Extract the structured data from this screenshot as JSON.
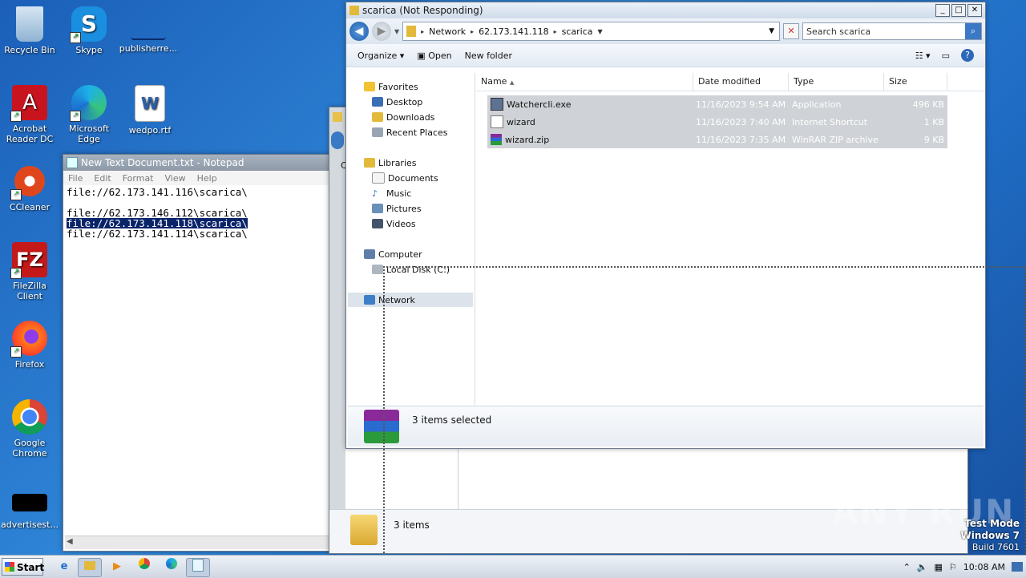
{
  "desktop": {
    "icons": [
      {
        "label": "Recycle Bin",
        "icon": "recycle-bin-icon"
      },
      {
        "label": "Skype",
        "icon": "skype-icon"
      },
      {
        "label": "publisherre...",
        "icon": "file-icon"
      },
      {
        "label": "Acrobat Reader DC",
        "icon": "acrobat-icon"
      },
      {
        "label": "Microsoft Edge",
        "icon": "edge-icon"
      },
      {
        "label": "wedpo.rtf",
        "icon": "word-document-icon"
      },
      {
        "label": "CCleaner",
        "icon": "ccleaner-icon"
      },
      {
        "label": "FileZilla Client",
        "icon": "filezilla-icon"
      },
      {
        "label": "Firefox",
        "icon": "firefox-icon"
      },
      {
        "label": "Google Chrome",
        "icon": "chrome-icon"
      },
      {
        "label": "advertisest...",
        "icon": "file-icon"
      }
    ]
  },
  "notepad": {
    "title": "New Text Document.txt - Notepad",
    "menu": [
      "File",
      "Edit",
      "Format",
      "View",
      "Help"
    ],
    "lines": [
      "file://62.173.141.116\\scarica\\",
      "",
      "file://62.173.146.112\\scarica\\",
      "file://62.173.141.118\\scarica\\",
      "file://62.173.141.114\\scarica\\"
    ]
  },
  "background_explorer": {
    "status_text": "3 items",
    "partial_letter": "C"
  },
  "explorer": {
    "title": "scarica (Not Responding)",
    "breadcrumb": [
      "Network",
      "62.173.141.118",
      "scarica"
    ],
    "search_placeholder": "Search scarica",
    "commands": {
      "organize": "Organize",
      "open": "Open",
      "new_folder": "New folder"
    },
    "nav": {
      "favorites": "Favorites",
      "desktop": "Desktop",
      "downloads": "Downloads",
      "recent": "Recent Places",
      "libraries": "Libraries",
      "documents": "Documents",
      "music": "Music",
      "pictures": "Pictures",
      "videos": "Videos",
      "computer": "Computer",
      "local_disk": "Local Disk (C:)",
      "network": "Network"
    },
    "columns": {
      "name": "Name",
      "date": "Date modified",
      "type": "Type",
      "size": "Size"
    },
    "files": [
      {
        "name": "Watchercli.exe",
        "date": "11/16/2023 9:54 AM",
        "type": "Application",
        "size": "496 KB",
        "icon": "application-icon"
      },
      {
        "name": "wizard",
        "date": "11/16/2023 7:40 AM",
        "type": "Internet Shortcut",
        "size": "1 KB",
        "icon": "internet-shortcut-icon"
      },
      {
        "name": "wizard.zip",
        "date": "11/16/2023 7:35 AM",
        "type": "WinRAR ZIP archive",
        "size": "9 KB",
        "icon": "winrar-icon"
      }
    ],
    "status_text": "3 items selected"
  },
  "taskbar": {
    "start_label": "Start",
    "clock": "10:08 AM"
  },
  "watermark": {
    "line1": "Test Mode",
    "line2": "Windows 7",
    "line3": "Build 7601",
    "brand": "ANY RUN"
  },
  "colors": {
    "selection": "#0a246a",
    "accent": "#3b78c6"
  }
}
